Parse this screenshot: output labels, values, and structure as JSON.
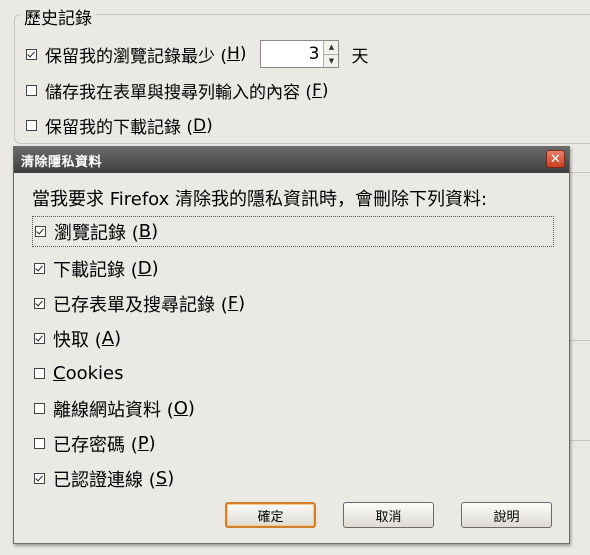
{
  "history": {
    "legend": "歷史記錄",
    "remember_visits": {
      "text": "保留我的瀏覽記錄最少 (",
      "key": "H",
      "close": ")",
      "checked": true,
      "value": "3",
      "unit": "天"
    },
    "remember_forms": {
      "text": "儲存我在表單與搜尋列輸入的內容 (",
      "key": "F",
      "close": ")",
      "checked": false
    },
    "remember_downloads": {
      "text": "保留我的下載記錄 (",
      "key": "D",
      "close": ")",
      "checked": false
    }
  },
  "dialog": {
    "title": "清除隱私資料",
    "prompt": "當我要求 Firefox 清除我的隱私資訊時，會刪除下列資料:",
    "options": [
      {
        "pre": "瀏覽記錄 (",
        "key": "B",
        "post": ")",
        "checked": true
      },
      {
        "pre": "下載記錄 (",
        "key": "D",
        "post": ")",
        "checked": true
      },
      {
        "pre": "已存表單及搜尋記錄 (",
        "key": "F",
        "post": ")",
        "checked": true
      },
      {
        "pre": "快取 (",
        "key": "A",
        "post": ")",
        "checked": true
      },
      {
        "pre": "",
        "key": "C",
        "post": "ookies",
        "checked": false
      },
      {
        "pre": "離線網站資料 (",
        "key": "O",
        "post": ")",
        "checked": false
      },
      {
        "pre": "已存密碼 (",
        "key": "P",
        "post": ")",
        "checked": false
      },
      {
        "pre": "已認證連線 (",
        "key": "S",
        "post": ")",
        "checked": true
      }
    ],
    "buttons": {
      "ok": "確定",
      "cancel": "取消",
      "help": "說明"
    }
  },
  "colors": {
    "titlebar": "#4a4a4a",
    "close": "#d4542f",
    "default_button_border": "#cf7f2e",
    "background": "#ebe9e4"
  }
}
